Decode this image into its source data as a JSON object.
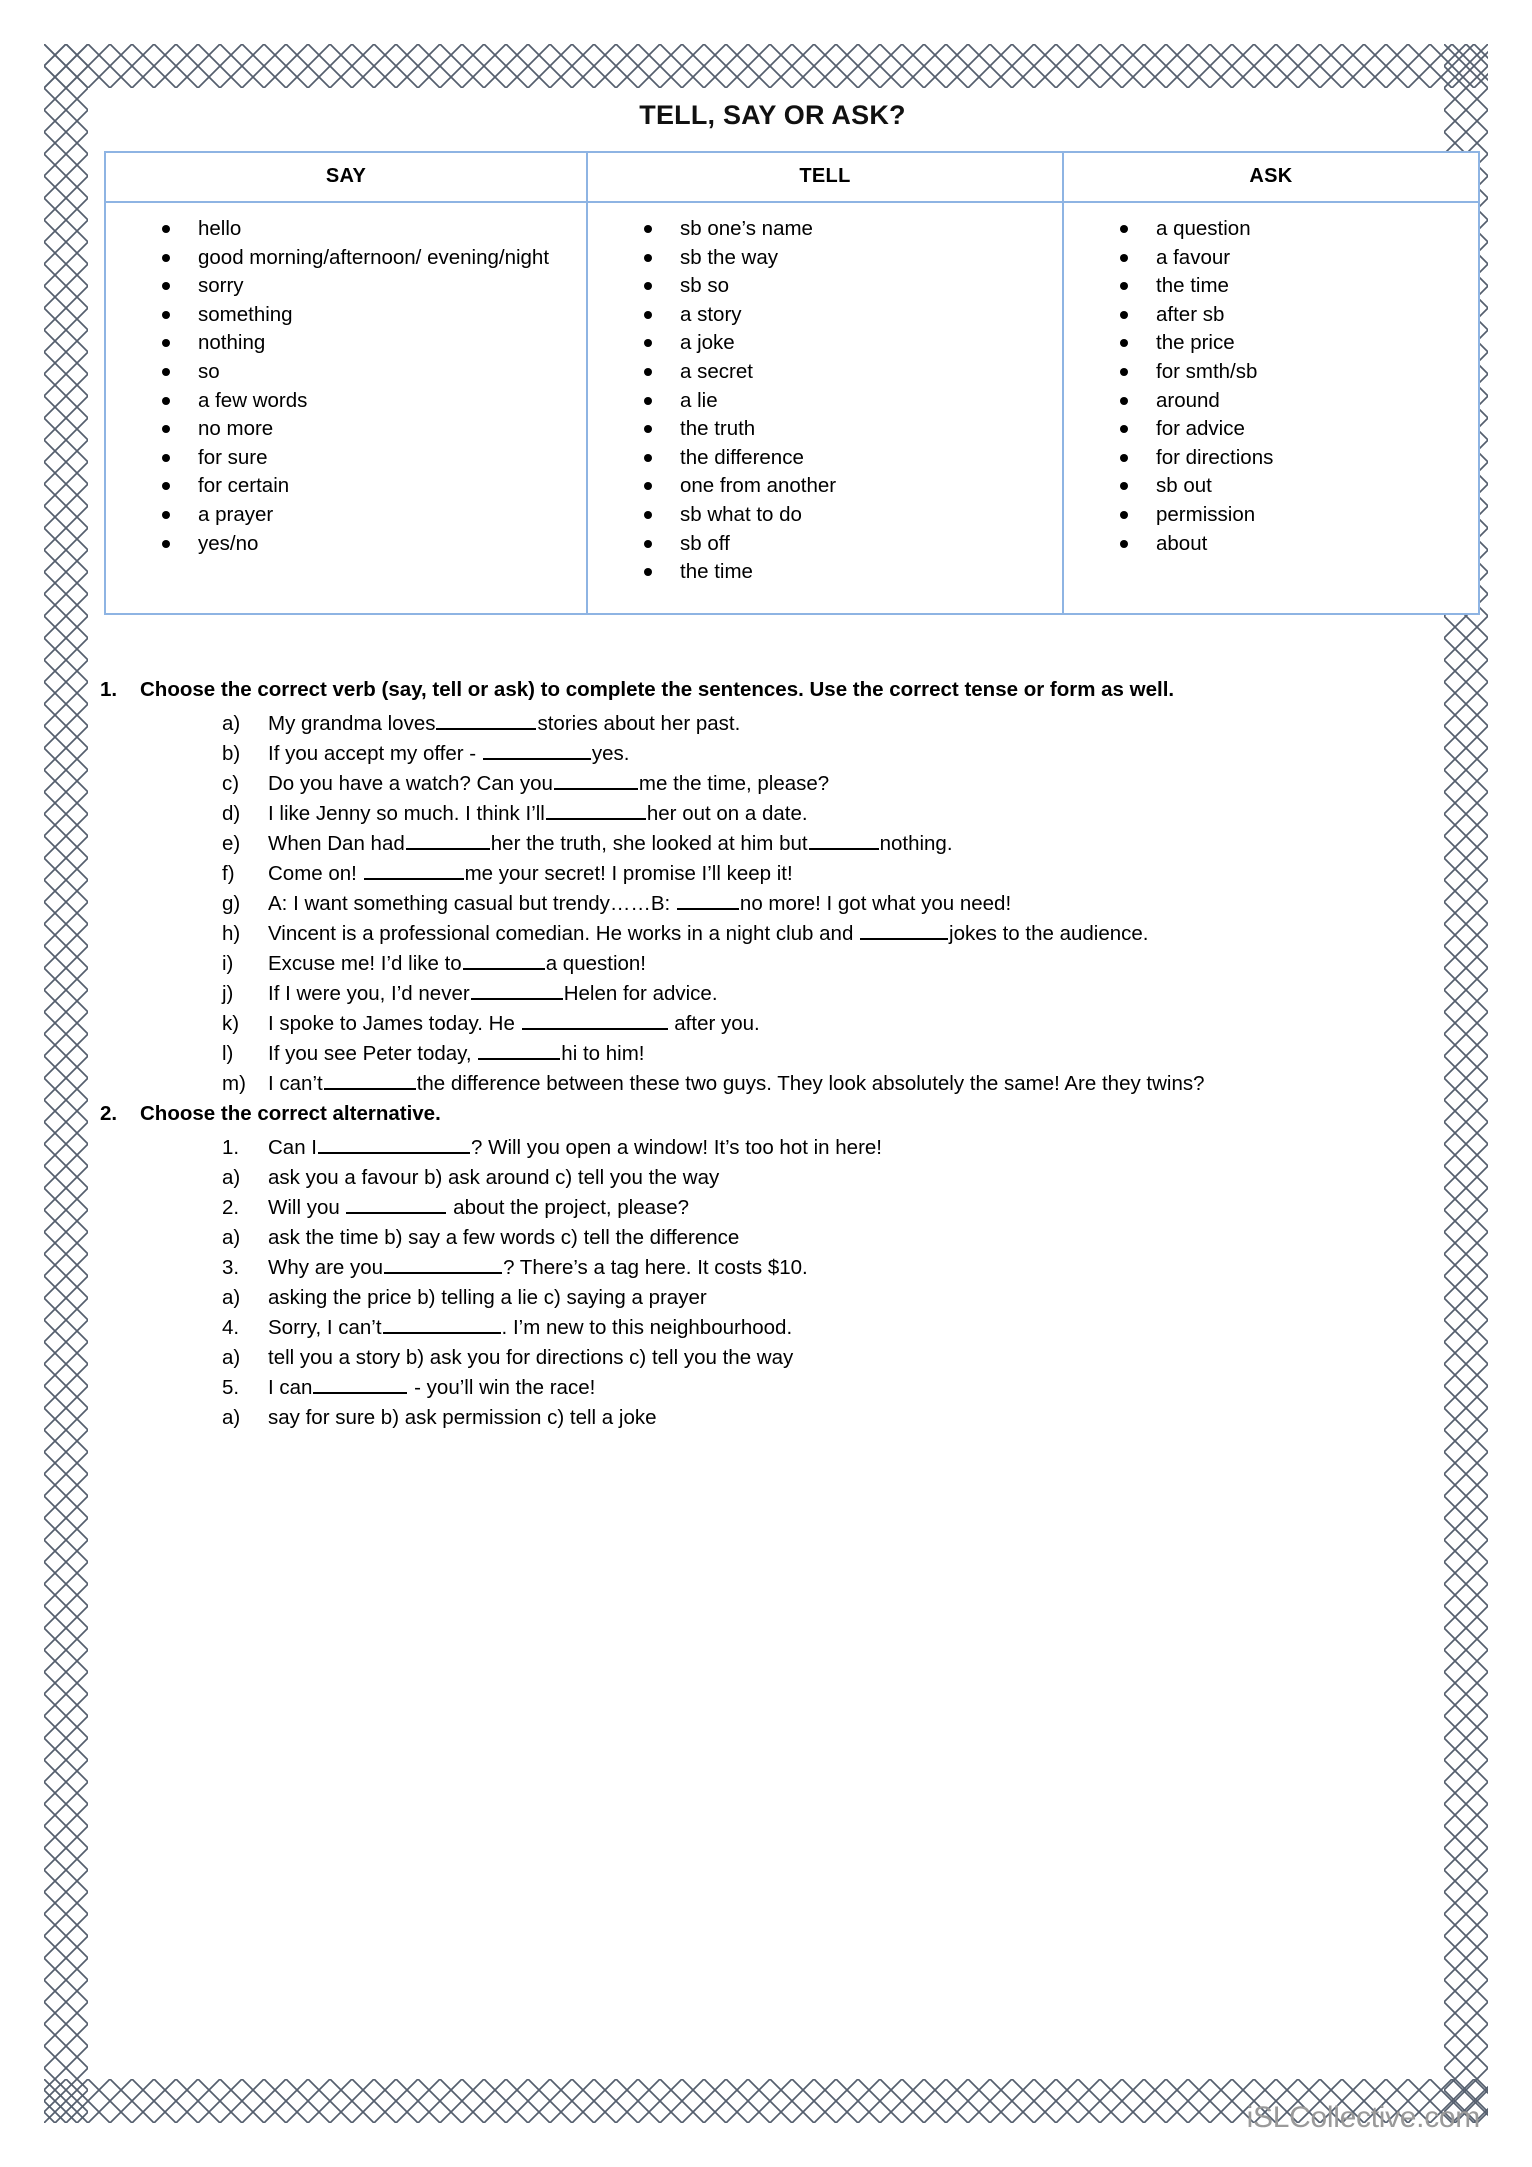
{
  "document": {
    "title": "TELL, SAY OR ASK?",
    "watermark": "iSLCollective.com",
    "border_color": "#555f6e",
    "table_border_color": "#8eb4e3"
  },
  "table": {
    "columns": [
      {
        "header": "SAY",
        "items": [
          "hello",
          "good morning/afternoon/ evening/night",
          "sorry",
          "something",
          "nothing",
          "so",
          "a few words",
          "no more",
          "for sure",
          "for certain",
          "a prayer",
          "yes/no"
        ]
      },
      {
        "header": "TELL",
        "items": [
          "sb one’s name",
          "sb the way",
          "sb so",
          "a story",
          "a joke",
          "a secret",
          "a lie",
          "the truth",
          "the difference",
          "one from another",
          "sb what to do",
          "sb off",
          "the time"
        ]
      },
      {
        "header": "ASK",
        "items": [
          "a question",
          "a favour",
          "the time",
          "after sb",
          "the price",
          "for smth/sb",
          "around",
          "for advice",
          "for directions",
          "sb out",
          "permission",
          "about"
        ]
      }
    ]
  },
  "exercise1": {
    "number": "1.",
    "instruction": "Choose the correct verb (say, tell or ask) to complete the sentences. Use the correct tense or form as well.",
    "items": [
      {
        "marker": "a)",
        "pre": "My grandma loves",
        "blank": 100,
        "post": "stories about her past."
      },
      {
        "marker": "b)",
        "pre": "If you accept my offer - ",
        "blank": 108,
        "post": "yes."
      },
      {
        "marker": "c)",
        "pre": "Do you have a watch? Can you",
        "blank": 84,
        "post": "me the time, please?"
      },
      {
        "marker": "d)",
        "pre": "I like Jenny so much. I think I’ll",
        "blank": 100,
        "post": "her out on a date."
      },
      {
        "marker": "e)",
        "pre": "When Dan had",
        "blank": 84,
        "post": "her the truth, she looked at him but",
        "blank2": 70,
        "post2": "nothing."
      },
      {
        "marker": "f)",
        "pre": "Come on! ",
        "blank": 100,
        "post": "me your secret! I promise I’ll keep it!"
      },
      {
        "marker": "g)",
        "pre": "A: I want something casual but trendy……B: ",
        "blank": 62,
        "post": "no more! I got what you need!"
      },
      {
        "marker": "h)",
        "pre": "Vincent is a professional comedian. He works in a night club and ",
        "blank": 88,
        "post": "jokes to the audience."
      },
      {
        "marker": "i)",
        "pre": "Excuse me! I’d like to",
        "blank": 82,
        "post": "a question!"
      },
      {
        "marker": "j)",
        "pre": "If I were you, I’d never",
        "blank": 92,
        "post": "Helen for advice."
      },
      {
        "marker": "k)",
        "pre": "I spoke to James today. He ",
        "blank": 146,
        "post": " after you."
      },
      {
        "marker": "l)",
        "pre": "If you see Peter today, ",
        "blank": 82,
        "post": "hi to him!"
      },
      {
        "marker": "m)",
        "pre": "I can’t",
        "blank": 92,
        "post": "the difference between these two guys. They look absolutely the same! Are they twins?"
      }
    ]
  },
  "exercise2": {
    "number": "2.",
    "instruction": "Choose the correct alternative.",
    "questions": [
      {
        "marker": "1.",
        "pre": "Can I",
        "blank": 152,
        "post": "? Will you open a window! It’s too hot in here!",
        "options_marker": "a)",
        "options": "ask you a favour b) ask around c) tell you the way"
      },
      {
        "marker": "2.",
        "pre": "Will you ",
        "blank": 100,
        "post": " about the project, please?",
        "options_marker": "a)",
        "options": "ask the time b) say a few words c) tell the difference"
      },
      {
        "marker": "3.",
        "pre": "Why are you",
        "blank": 118,
        "post": "? There’s a tag here. It costs $10.",
        "options_marker": "a)",
        "options": "asking the price b) telling a lie c) saying a prayer"
      },
      {
        "marker": "4.",
        "pre": "Sorry, I can’t",
        "blank": 118,
        "post": ". I’m new to this neighbourhood.",
        "options_marker": "a)",
        "options": "tell you a story b) ask you for directions c) tell you the way"
      },
      {
        "marker": "5.",
        "pre": "I can",
        "blank": 94,
        "post": " - you’ll win the race!",
        "options_marker": "a)",
        "options": "say for sure b) ask permission c) tell a joke"
      }
    ]
  }
}
